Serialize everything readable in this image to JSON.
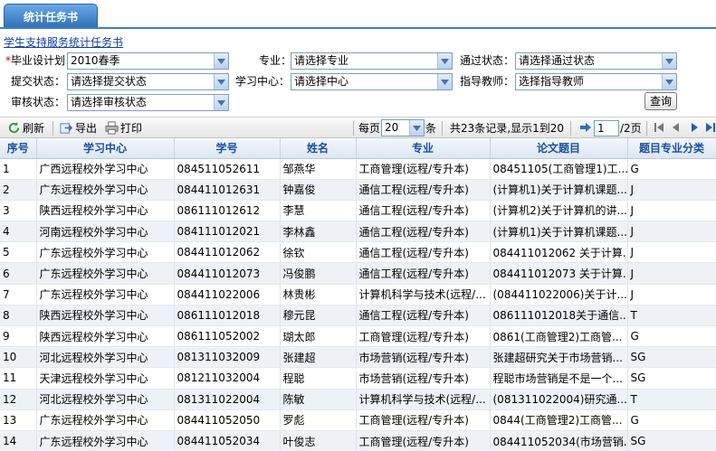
{
  "tab": {
    "label": "统计任务书"
  },
  "page_title": "学生支持服务统计任务书",
  "filters": {
    "graduation_plan": {
      "label": "毕业设计划：",
      "required_mark": "*",
      "value": "2010春季"
    },
    "major": {
      "label": "专业：",
      "value": "请选择专业"
    },
    "pass_status": {
      "label": "通过状态：",
      "value": "请选择通过状态"
    },
    "submit_status": {
      "label": "提交状态：",
      "value": "请选择提交状态"
    },
    "study_center": {
      "label": "学习中心：",
      "value": "请选择中心"
    },
    "advisor": {
      "label": "指导教师：",
      "value": "选择指导教师"
    },
    "review_status": {
      "label": "审核状态：",
      "value": "请选择审核状态"
    },
    "query_button": "查询"
  },
  "toolbar": {
    "refresh": "刷新",
    "export": "导出",
    "print": "打印",
    "per_page_prefix": "每页",
    "per_page_value": "20",
    "per_page_suffix": "条",
    "record_info": "共23条记录,显示1到20",
    "page_value": "1",
    "page_total": "/2页"
  },
  "table": {
    "columns": [
      "序号",
      "学习中心",
      "学号",
      "姓名",
      "专业",
      "论文题目",
      "题目专业分类"
    ],
    "rows": [
      [
        "1",
        "广西远程校外学习中心",
        "084511052611",
        "邹燕华",
        "工商管理(远程/专升本)",
        "08451105(工商管理1)工...",
        "G"
      ],
      [
        "2",
        "广东远程校外学习中心",
        "084411012631",
        "钟嘉俊",
        "通信工程(远程/专升本)",
        "(计算机1)关于计算机课题...",
        "J"
      ],
      [
        "3",
        "陕西远程校外学习中心",
        "086111012612",
        "李慧",
        "通信工程(远程/专升本)",
        "(计算机2)关于计算机的讲...",
        "J"
      ],
      [
        "4",
        "河南远程校外学习中心",
        "084111012021",
        "李林鑫",
        "通信工程(远程/专升本)",
        "(计算机1)关于计算机课题...",
        "J"
      ],
      [
        "5",
        "广东远程校外学习中心",
        "084411012062",
        "徐钦",
        "通信工程(远程/专升本)",
        "084411012062 关于计算...",
        "J"
      ],
      [
        "6",
        "广东远程校外学习中心",
        "084411012073",
        "冯俊鹏",
        "通信工程(远程/专升本)",
        "084411012073 关于计算...",
        "J"
      ],
      [
        "7",
        "广东远程校外学习中心",
        "084411022006",
        "林贵彬",
        "计算机科学与技术(远程/...",
        "(084411022006)关于计...",
        "J"
      ],
      [
        "8",
        "陕西远程校外学习中心",
        "086111012018",
        "穆元昆",
        "通信工程(远程/专升本)",
        "086111012018关于通信...",
        "T"
      ],
      [
        "9",
        "陕西远程校外学习中心",
        "086111052002",
        "瑚太郎",
        "工商管理(远程/专升本)",
        "0861(工商管理2)工商管...",
        "G"
      ],
      [
        "10",
        "河北远程校外学习中心",
        "081311032009",
        "张建超",
        "市场营销(远程/专升本)",
        "张建超研究关于市场营销...",
        "SG"
      ],
      [
        "11",
        "天津远程校外学习中心",
        "081211032004",
        "程聪",
        "市场营销(远程/专升本)",
        "程聪市场营销是不是一个...",
        "SG"
      ],
      [
        "12",
        "河北远程校外学习中心",
        "081311022004",
        "陈敏",
        "计算机科学与技术(远程/...",
        "(081311022004)研究通...",
        "T"
      ],
      [
        "13",
        "广东远程校外学习中心",
        "084411052050",
        "罗彪",
        "工商管理(远程/专升本)",
        "0844(工商管理2)工商管...",
        "G"
      ],
      [
        "14",
        "广东远程校外学习中心",
        "084411052034",
        "叶俊志",
        "工商管理(远程/专升本)",
        "084411052034(市场营销...",
        "SG"
      ]
    ]
  },
  "colors": {
    "header_text": "#1a4fa0",
    "alt_row": "#eef2f7",
    "tab": "#2e6fb8"
  }
}
